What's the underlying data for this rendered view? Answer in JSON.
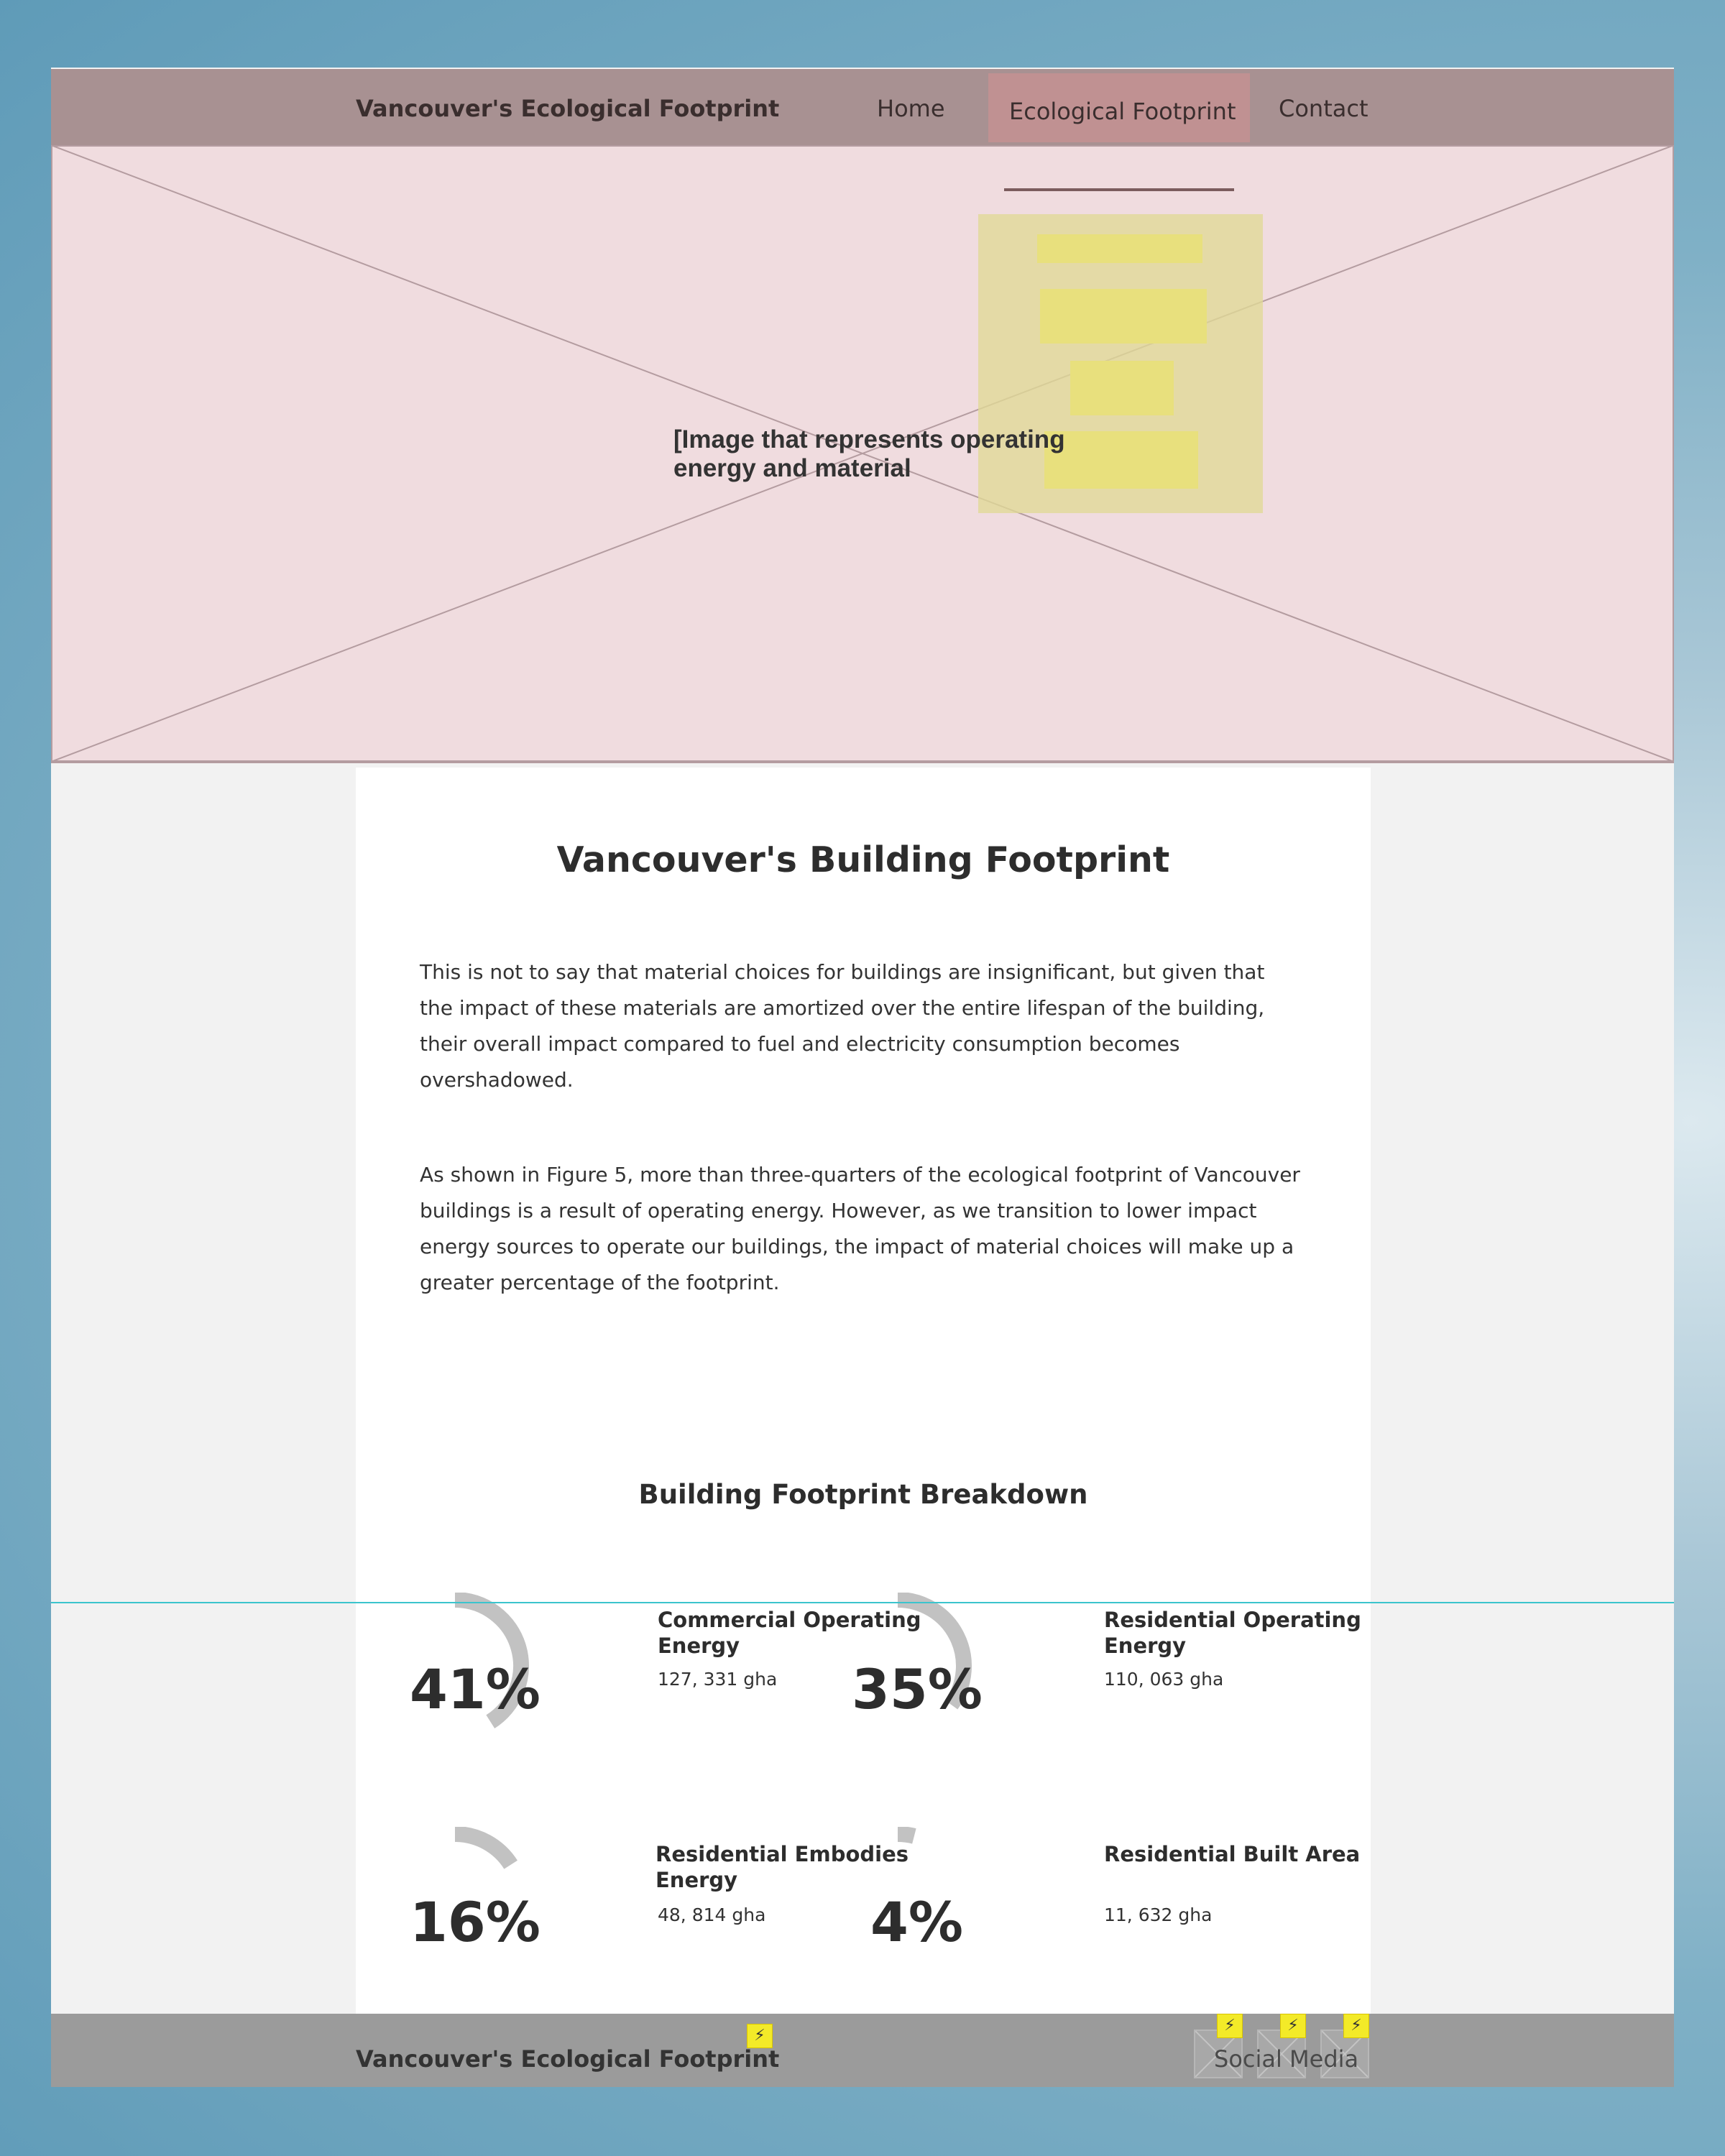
{
  "header": {
    "brand": "Vancouver's Ecological Footprint",
    "nav": [
      {
        "label": "Home"
      },
      {
        "label": "Ecological Footprint",
        "active": true
      },
      {
        "label": "Contact"
      }
    ]
  },
  "hero": {
    "caption": "[Image that represents operating energy and material"
  },
  "main": {
    "title": "Vancouver's Building Footprint",
    "paragraphs": [
      "This is not to say that material choices for buildings are insignificant, but given that the impact of these materials are amortized over the entire lifespan of the building, their overall impact compared to fuel and electricity consumption becomes overshadowed.",
      "As shown in Figure 5, more than three-quarters of the ecological footprint of Vancouver buildings is a result of operating energy.  However, as we transition to lower impact energy sources to operate our buildings, the impact of material choices will make up a greater percentage of the footprint."
    ],
    "breakdown_title": "Building Footprint Breakdown",
    "stats": [
      {
        "percent": "41%",
        "fraction": 0.41,
        "title": "Commercial Operating Energy",
        "value": "127, 331 gha"
      },
      {
        "percent": "35%",
        "fraction": 0.35,
        "title": "Residential Operating Energy",
        "value": "110, 063 gha"
      },
      {
        "percent": "16%",
        "fraction": 0.16,
        "title": "Residential Embodies Energy",
        "value": "48, 814 gha"
      },
      {
        "percent": "4%",
        "fraction": 0.04,
        "title": "Residential Built Area",
        "value": "11, 632 gha"
      }
    ]
  },
  "footer": {
    "brand": "Vancouver's Ecological Footprint",
    "social_label": "Social Media"
  },
  "colors": {
    "nav_bar": "#a89192",
    "hero_placeholder": "#f0dcdf",
    "ring": "#c2c2c2",
    "footer": "#9b9b9b",
    "dropdown_highlight": "#e8e07d",
    "guide_line": "#3bc4cd",
    "annotation_bolt": "#f3ea28"
  },
  "icons": [
    "lightning-bolt-icon",
    "image-placeholder-icon"
  ]
}
